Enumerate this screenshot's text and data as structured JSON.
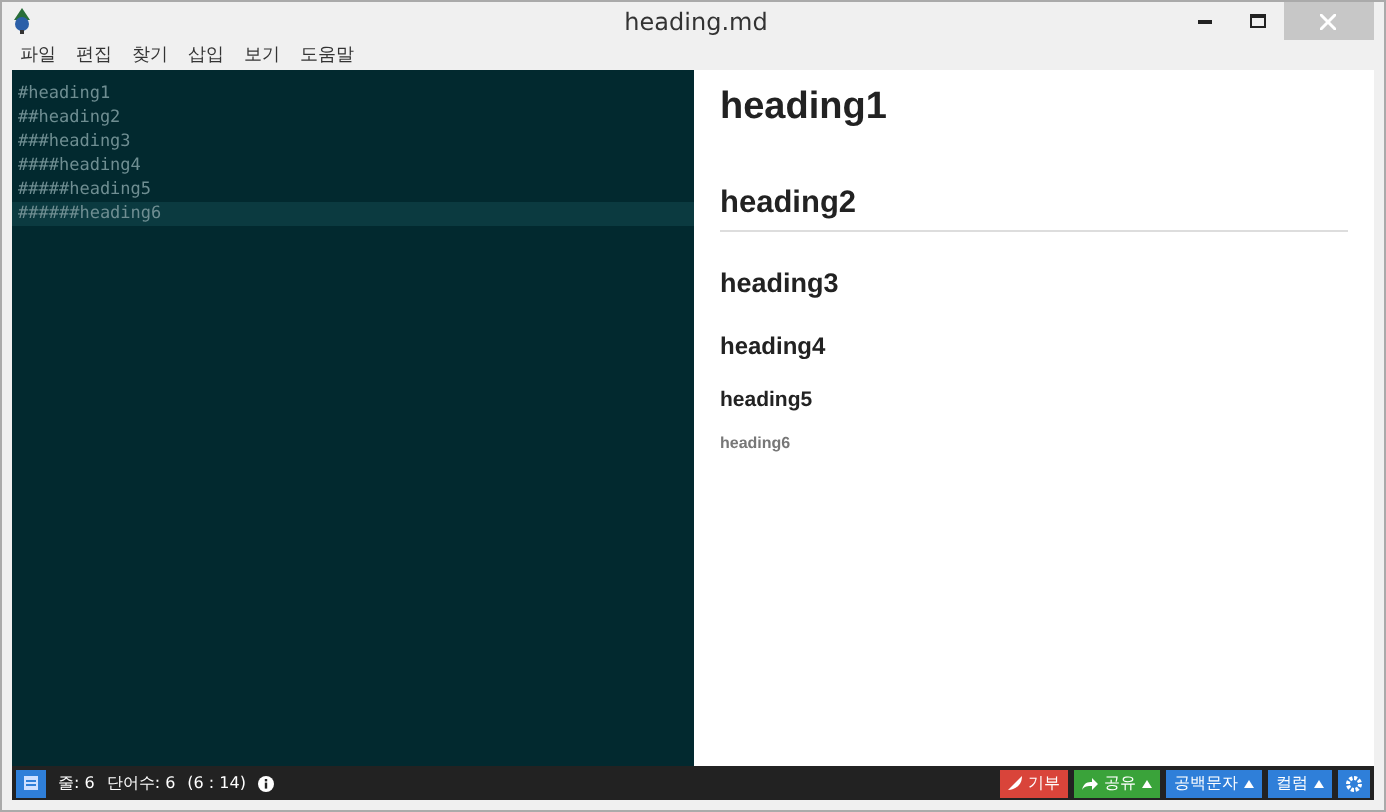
{
  "window": {
    "title": "heading.md"
  },
  "menu": [
    "파일",
    "편집",
    "찾기",
    "삽입",
    "보기",
    "도움말"
  ],
  "editor": {
    "lines": [
      {
        "text": "#heading1",
        "selected": false
      },
      {
        "text": "##heading2",
        "selected": false
      },
      {
        "text": "###heading3",
        "selected": false
      },
      {
        "text": "####heading4",
        "selected": false
      },
      {
        "text": "#####heading5",
        "selected": false
      },
      {
        "text": "######heading6",
        "selected": true
      }
    ]
  },
  "preview": {
    "headings": [
      {
        "kind": "h1",
        "text": "heading1"
      },
      {
        "kind": "h2",
        "text": "heading2"
      },
      {
        "kind": "h3",
        "text": "heading3"
      },
      {
        "kind": "h4",
        "text": "heading4"
      },
      {
        "kind": "h5",
        "text": "heading5"
      },
      {
        "kind": "h6",
        "text": "heading6"
      }
    ]
  },
  "status_bar": {
    "lines": "줄: 6",
    "words": "단어수: 6",
    "position": "(6 : 14)",
    "buttons": [
      {
        "kind": "donate",
        "label": "기부",
        "color": "#d9443a"
      },
      {
        "kind": "share",
        "label": "공유",
        "color": "#3aa33a"
      },
      {
        "kind": "menu",
        "label": "공백문자",
        "color": "#2f7fd9"
      },
      {
        "kind": "menu",
        "label": "컬럼",
        "color": "#2f7fd9"
      },
      {
        "kind": "settings",
        "color": "#2f7fd9"
      }
    ]
  }
}
